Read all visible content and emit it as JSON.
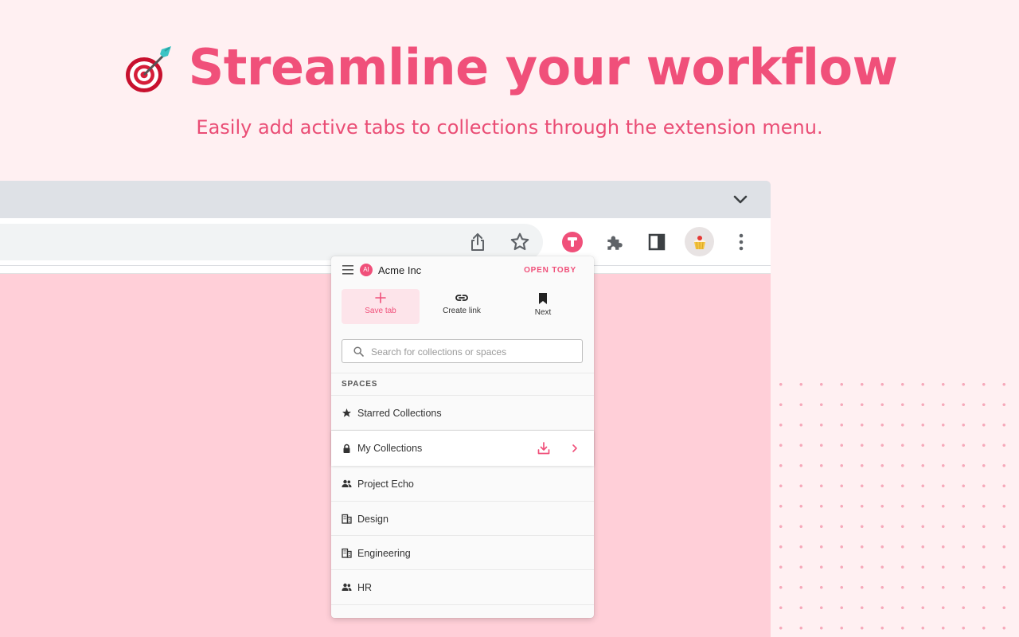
{
  "hero": {
    "title": "Streamline your workflow",
    "subtitle": "Easily add active tabs to collections through the extension menu.",
    "icon": "dart-target-icon"
  },
  "colors": {
    "accent": "#f0507a",
    "background": "#fff0f2",
    "page": "#ffcfd8"
  },
  "popup": {
    "org_badge": "AI",
    "org_name": "Acme Inc",
    "open_link": "OPEN TOBY",
    "actions": [
      {
        "label": "Save tab",
        "icon": "plus-icon"
      },
      {
        "label": "Create link",
        "icon": "link-icon"
      },
      {
        "label": "Next",
        "icon": "bookmark-icon"
      }
    ],
    "search_placeholder": "Search for collections or spaces",
    "spaces_label": "SPACES",
    "spaces": [
      {
        "label": "Starred Collections",
        "icon": "star-icon"
      },
      {
        "label": "My Collections",
        "icon": "lock-icon"
      },
      {
        "label": "Project Echo",
        "icon": "people-icon"
      },
      {
        "label": "Design",
        "icon": "building-icon"
      },
      {
        "label": "Engineering",
        "icon": "building-icon"
      },
      {
        "label": "HR",
        "icon": "people-icon"
      }
    ]
  }
}
